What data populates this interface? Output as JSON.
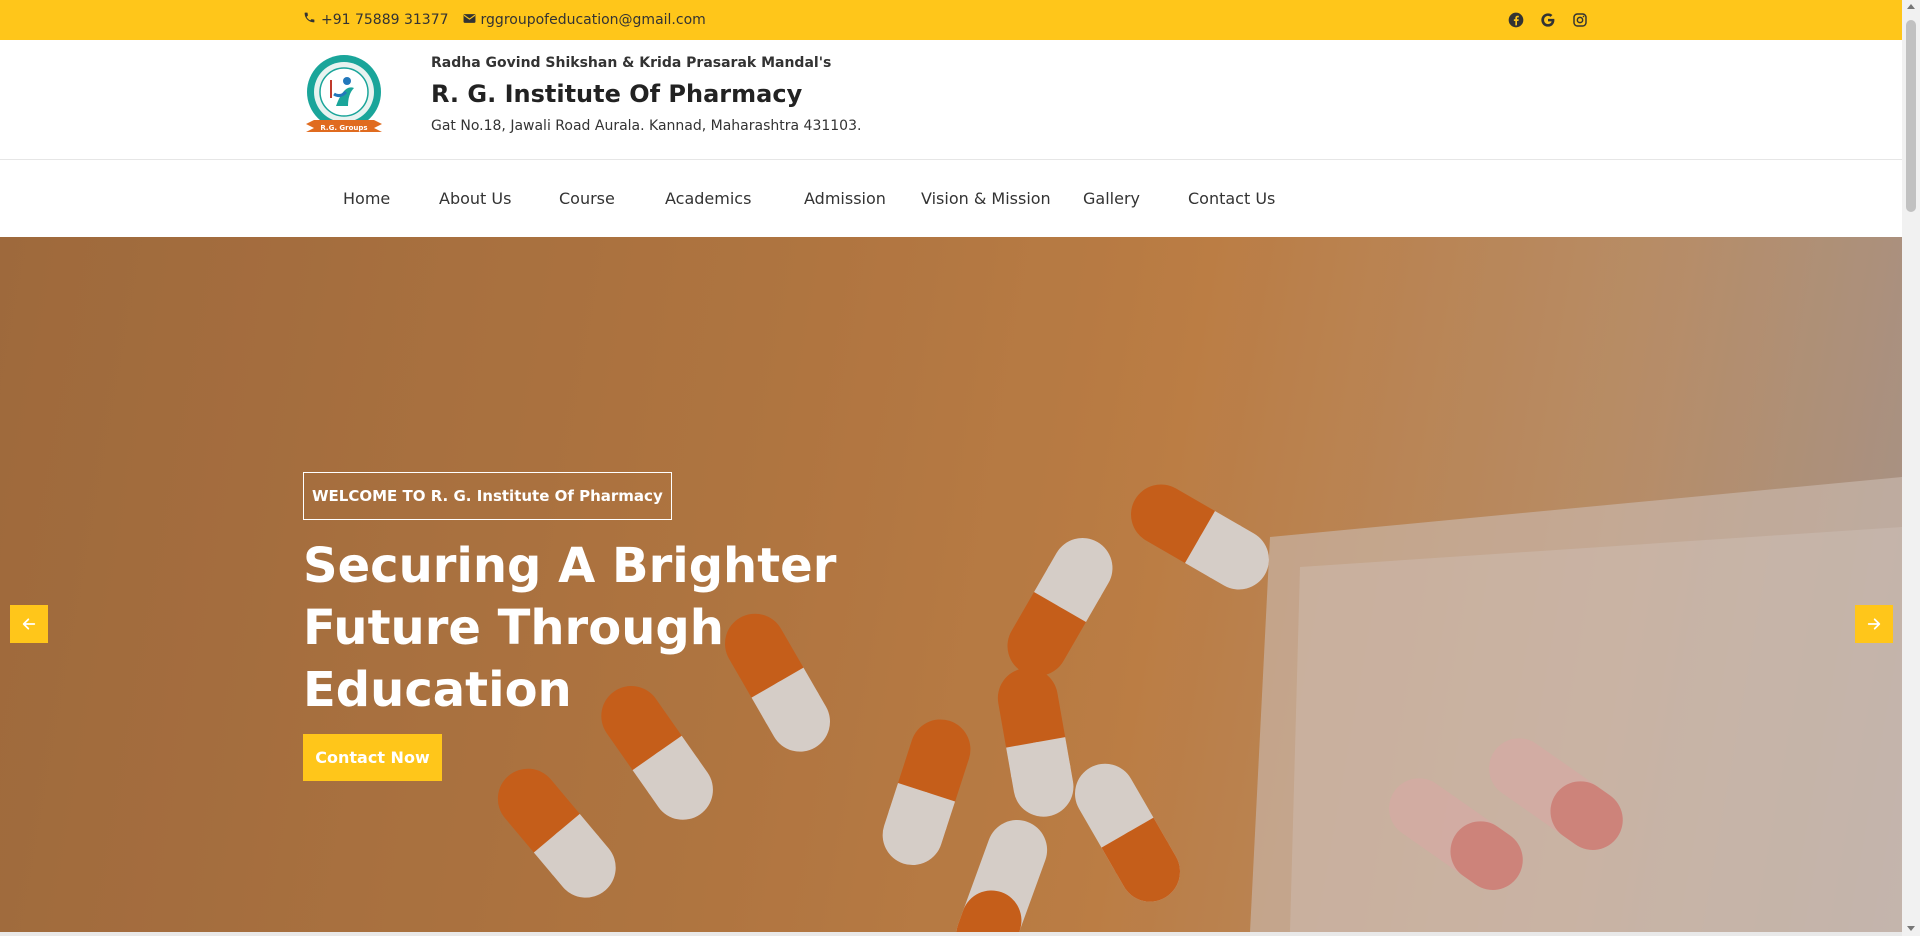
{
  "topbar": {
    "phone": "+91 75889 31377",
    "email": "rggroupofeducation@gmail.com",
    "social": [
      "facebook-icon",
      "google-icon",
      "instagram-icon"
    ],
    "background": "#ffc61a"
  },
  "header": {
    "org": "Radha Govind Shikshan & Krida Prasarak Mandal's",
    "title": "R. G. Institute Of Pharmacy",
    "address": "Gat No.18, Jawali Road Aurala. Kannad, Maharashtra 431103.",
    "logo_ribbon": "R.G. Groups"
  },
  "nav": {
    "items": [
      "Home",
      "About Us",
      "Course",
      "Academics",
      "Admission",
      "Vision & Mission",
      "Gallery",
      "Contact Us"
    ]
  },
  "hero": {
    "welcome": "WELCOME TO R. G. Institute Of Pharmacy",
    "headline_lines": [
      "Securing A Brighter",
      "Future Through",
      "Education"
    ],
    "cta": "Contact Now",
    "prev_icon": "arrow-left-icon",
    "next_icon": "arrow-right-icon",
    "accent": "#ffc61a"
  }
}
